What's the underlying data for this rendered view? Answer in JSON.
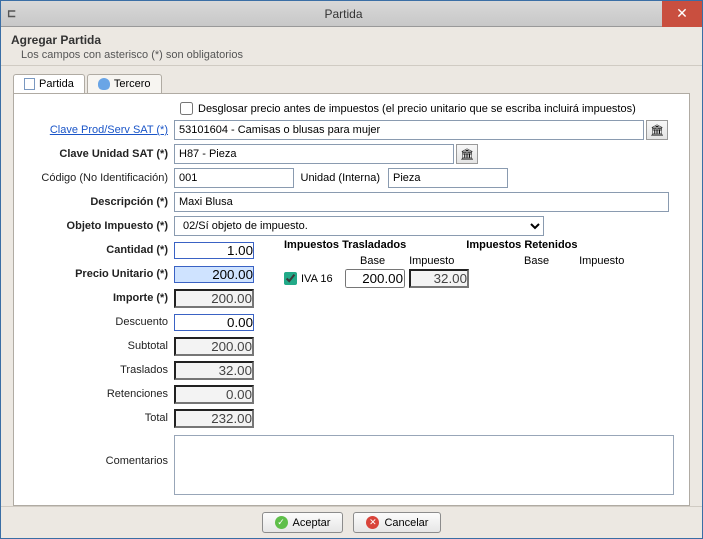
{
  "window": {
    "title": "Partida",
    "close": "✕",
    "appglyph": "⊏"
  },
  "header": {
    "title": "Agregar Partida",
    "subtitle": "Los campos con asterisco (*) son obligatorios"
  },
  "tabs": {
    "partida": "Partida",
    "tercero": "Tercero"
  },
  "desglosar": {
    "label": "Desglosar precio antes de impuestos (el precio unitario que se escriba incluirá impuestos)",
    "checked": false
  },
  "labels": {
    "claveProdServ": "Clave Prod/Serv SAT (*)",
    "claveUnidad": "Clave Unidad SAT (*)",
    "codigo": "Código (No Identificación)",
    "unidadInterna": "Unidad (Interna)",
    "descripcion": "Descripción (*)",
    "objetoImpuesto": "Objeto Impuesto (*)",
    "cantidad": "Cantidad (*)",
    "precioUnitario": "Precio Unitario (*)",
    "importe": "Importe (*)",
    "descuento": "Descuento",
    "subtotal": "Subtotal",
    "traslados": "Traslados",
    "retenciones": "Retenciones",
    "total": "Total",
    "comentarios": "Comentarios"
  },
  "values": {
    "claveProdServ": "53101604 - Camisas o blusas para mujer",
    "claveUnidad": "H87 - Pieza",
    "codigo": "001",
    "unidadInterna": "Pieza",
    "descripcion": "Maxi Blusa",
    "objetoImpuesto": "02/Sí objeto de impuesto.",
    "cantidad": "1.00",
    "precioUnitario": "200.00",
    "importe": "200.00",
    "descuento": "0.00",
    "subtotal": "200.00",
    "traslados": "32.00",
    "retenciones": "0.00",
    "total": "232.00",
    "comentarios": ""
  },
  "taxes": {
    "trasladadosHeader": "Impuestos Trasladados",
    "retenidosHeader": "Impuestos Retenidos",
    "baseLabel": "Base",
    "impuestoLabel": "Impuesto",
    "rows": [
      {
        "checked": true,
        "name": "IVA 16",
        "base": "200.00",
        "impuesto": "32.00"
      }
    ]
  },
  "buttons": {
    "aceptar": "Aceptar",
    "cancelar": "Cancelar"
  },
  "icons": {
    "lookup": "🏛"
  }
}
